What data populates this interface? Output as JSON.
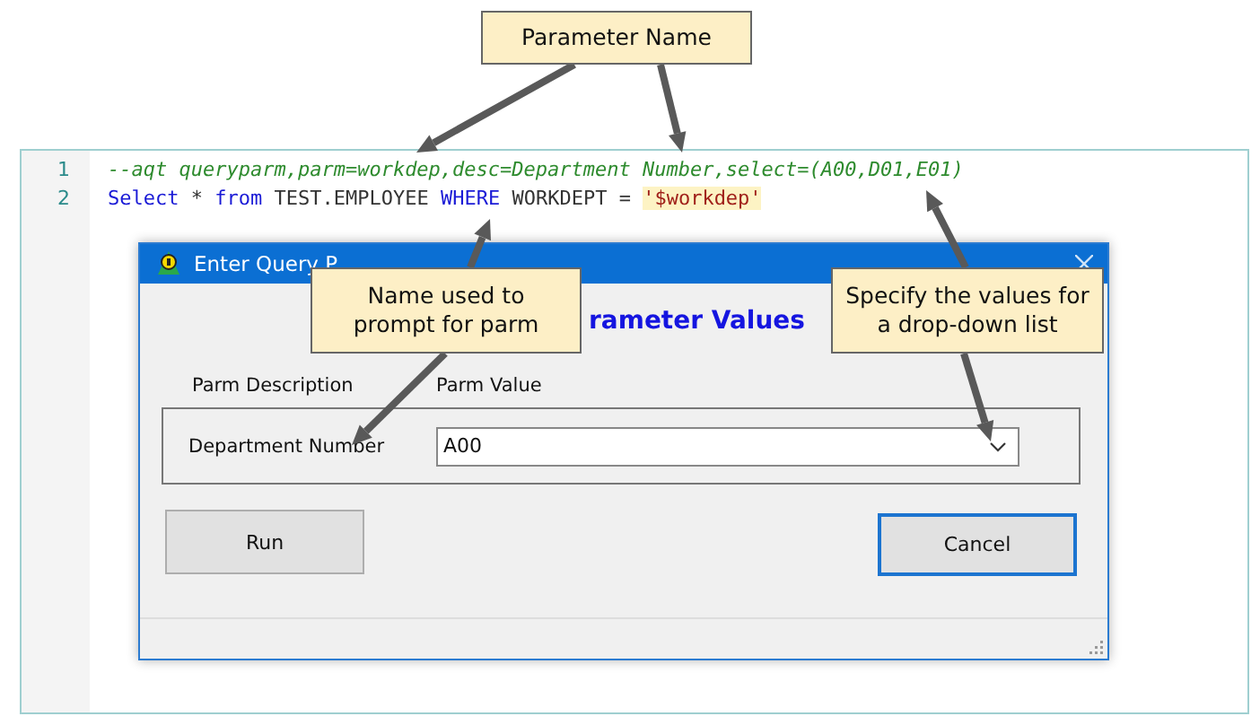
{
  "editor": {
    "lines": [
      {
        "number": "1",
        "tokens": [
          {
            "kind": "comment",
            "text": "--aqt queryparm,parm=workdep,desc=Department Number,select=(A00,D01,E01)"
          }
        ]
      },
      {
        "number": "2",
        "tokens": [
          {
            "kind": "keyword",
            "text": "Select"
          },
          {
            "kind": "plain",
            "text": " * "
          },
          {
            "kind": "keyword",
            "text": "from"
          },
          {
            "kind": "plain",
            "text": " TEST.EMPLOYEE "
          },
          {
            "kind": "keyword",
            "text": "WHERE"
          },
          {
            "kind": "plain",
            "text": " WORKDEPT = "
          },
          {
            "kind": "string",
            "text": "'$workdep'"
          }
        ]
      }
    ]
  },
  "dialog": {
    "title": "Enter Query P",
    "heading": "rameter Values",
    "columns": [
      "Parm Description",
      "Parm Value"
    ],
    "params": [
      {
        "description": "Department Number",
        "value": "A00"
      }
    ],
    "buttons": [
      {
        "label": "Run",
        "focused": false
      },
      {
        "label": "Cancel",
        "focused": true
      }
    ]
  },
  "callouts": [
    {
      "text": "Parameter Name"
    },
    {
      "text": "Name used to prompt for parm"
    },
    {
      "text": "Specify the values for a drop-down list"
    }
  ]
}
